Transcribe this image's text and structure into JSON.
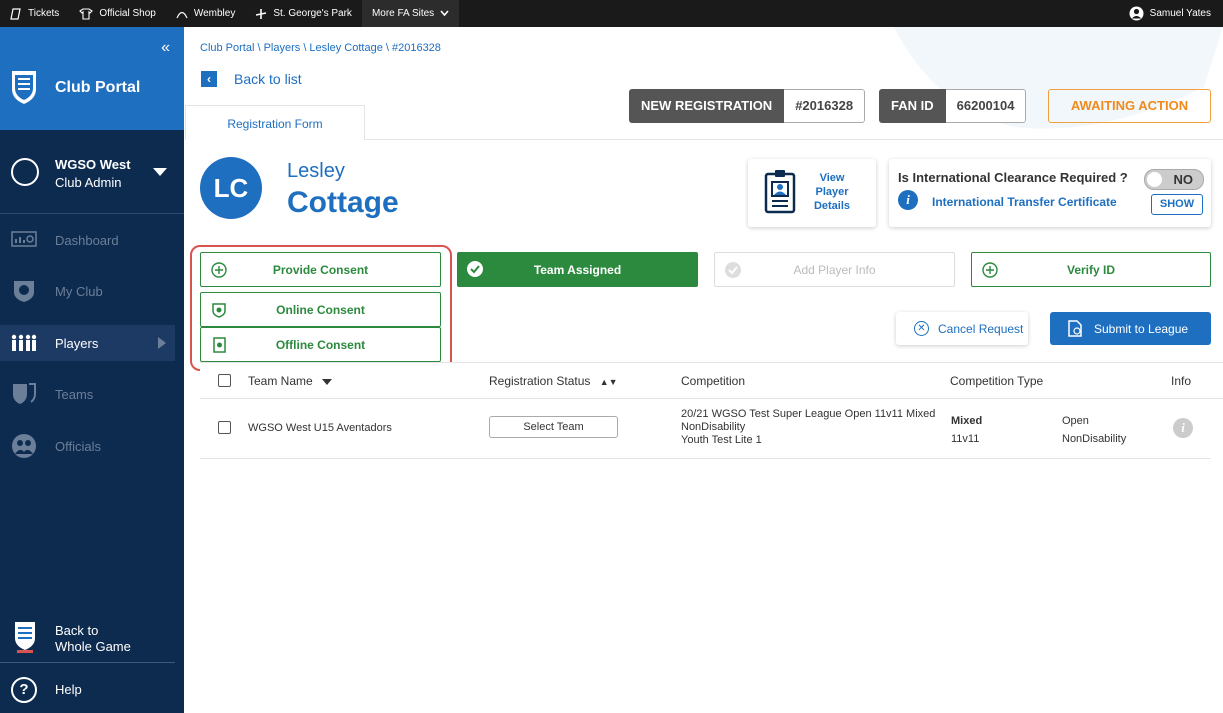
{
  "topbar": {
    "links": [
      "Tickets",
      "Official Shop",
      "Wembley",
      "St. George's Park",
      "More FA Sites"
    ],
    "user": "Samuel Yates"
  },
  "sidebar": {
    "title": "Club Portal",
    "club_name": "WGSO West",
    "club_role": "Club Admin",
    "items": [
      {
        "label": "Dashboard"
      },
      {
        "label": "My Club"
      },
      {
        "label": "Players"
      },
      {
        "label": "Teams"
      },
      {
        "label": "Officials"
      }
    ],
    "back_line1": "Back to",
    "back_line2": "Whole Game",
    "help": "Help"
  },
  "breadcrumb": "Club Portal \\ Players \\ Lesley Cottage \\ #2016328",
  "back_label": "Back to list",
  "tab_label": "Registration Form",
  "badges": {
    "registration_key": "NEW REGISTRATION",
    "registration_value": "#2016328",
    "fan_key": "FAN ID",
    "fan_value": "66200104",
    "status": "AWAITING ACTION"
  },
  "player": {
    "initials": "LC",
    "first_name": "Lesley",
    "last_name": "Cottage"
  },
  "view_player": {
    "line1": "View",
    "line2": "Player",
    "line3": "Details"
  },
  "international": {
    "question": "Is International Clearance Required ?",
    "toggle": "NO",
    "certificate": "International Transfer Certificate",
    "show": "SHOW"
  },
  "actions": {
    "provide_consent": "Provide Consent",
    "online_consent": "Online Consent",
    "offline_consent": "Offline Consent",
    "team_assigned": "Team Assigned",
    "add_player_info": "Add Player Info",
    "verify_id": "Verify ID",
    "cancel_request": "Cancel Request",
    "submit": "Submit to League"
  },
  "table": {
    "headers": [
      "Team Name",
      "Registration Status",
      "Competition",
      "Competition Type",
      "Info"
    ],
    "rows": [
      {
        "team": "WGSO West U15 Aventadors",
        "status_button": "Select Team",
        "competition_1": "20/21 WGSO Test Super League Open 11v11 Mixed",
        "competition_2": "NonDisability",
        "competition_3": "Youth Test Lite 1",
        "type_gender": "Mixed",
        "type_format": "11v11",
        "type_age": "Open",
        "type_disability": "NonDisability"
      }
    ]
  },
  "colors": {
    "brand": "#1e6fc0",
    "sidebar": "#0d2a4f",
    "green": "#2c8a3e",
    "orange": "#f08a1c",
    "highlight": "#d9534f"
  }
}
